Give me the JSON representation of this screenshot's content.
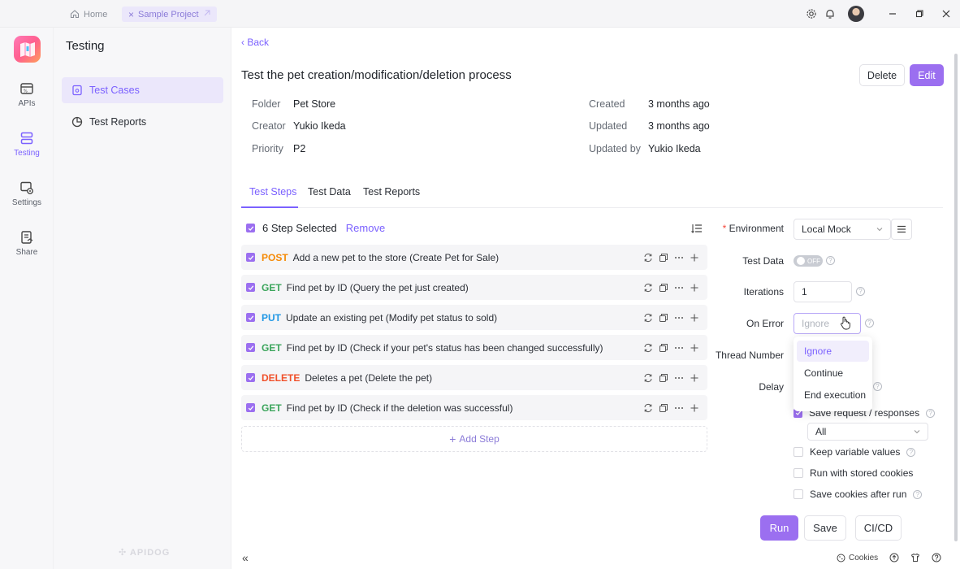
{
  "titlebar": {
    "home_tab": "Home",
    "project_tab": "Sample Project"
  },
  "rail": {
    "items": [
      {
        "label": "APIs",
        "icon": "api-icon"
      },
      {
        "label": "Testing",
        "icon": "testing-icon"
      },
      {
        "label": "Settings",
        "icon": "settings-icon"
      },
      {
        "label": "Share",
        "icon": "share-icon"
      }
    ],
    "brand": "APIDOG"
  },
  "sidebar": {
    "title": "Testing",
    "items": [
      {
        "label": "Test Cases",
        "icon": "test-case-icon"
      },
      {
        "label": "Test Reports",
        "icon": "pie-chart-icon"
      }
    ]
  },
  "main": {
    "back": "Back",
    "title": "Test the pet creation/modification/deletion process",
    "delete_label": "Delete",
    "edit_label": "Edit",
    "meta": {
      "folder_label": "Folder",
      "folder": "Pet Store",
      "creator_label": "Creator",
      "creator": "Yukio Ikeda",
      "priority_label": "Priority",
      "priority": "P2",
      "created_label": "Created",
      "created": "3 months ago",
      "updated_label": "Updated",
      "updated": "3 months ago",
      "updated_by_label": "Updated by",
      "updated_by": "Yukio Ikeda"
    },
    "tabs": [
      "Test Steps",
      "Test Data",
      "Test Reports"
    ],
    "selection": {
      "text": "6 Step Selected",
      "remove": "Remove"
    },
    "steps": [
      {
        "method": "POST",
        "color": "#f58a07",
        "name": "Add a new pet to the store (Create Pet for Sale)"
      },
      {
        "method": "GET",
        "color": "#3ca55c",
        "name": "Find pet by ID (Query the pet just created)"
      },
      {
        "method": "PUT",
        "color": "#1f97e5",
        "name": "Update an existing pet (Modify pet status to sold)"
      },
      {
        "method": "GET",
        "color": "#3ca55c",
        "name": "Find pet by ID (Check if your pet's status has been changed successfully)"
      },
      {
        "method": "DELETE",
        "color": "#f0502a",
        "name": "Deletes a pet (Delete the pet)"
      },
      {
        "method": "GET",
        "color": "#3ca55c",
        "name": "Find pet by ID (Check if the deletion was successful)"
      }
    ],
    "add_step": "Add Step"
  },
  "config": {
    "environment_label": "Environment",
    "environment_value": "Local Mock",
    "test_data_label": "Test Data",
    "test_data_toggle": "OFF",
    "iterations_label": "Iterations",
    "iterations_value": "1",
    "on_error_label": "On Error",
    "on_error_placeholder": "Ignore",
    "thread_number_label": "Thread Number",
    "delay_label": "Delay",
    "on_error_options": [
      "Ignore",
      "Continue",
      "End execution"
    ],
    "save_request_label": "Save request / responses",
    "save_request_scope": "All",
    "keep_variable_label": "Keep variable values",
    "run_cookies_label": "Run with stored cookies",
    "save_cookies_label": "Save cookies after run",
    "run_label": "Run",
    "save_label": "Save",
    "cicd_label": "CI/CD"
  },
  "footer": {
    "cookies_label": "Cookies"
  },
  "colors": {
    "accent": "#7b61ff",
    "primary_button": "#9b6ff0"
  }
}
